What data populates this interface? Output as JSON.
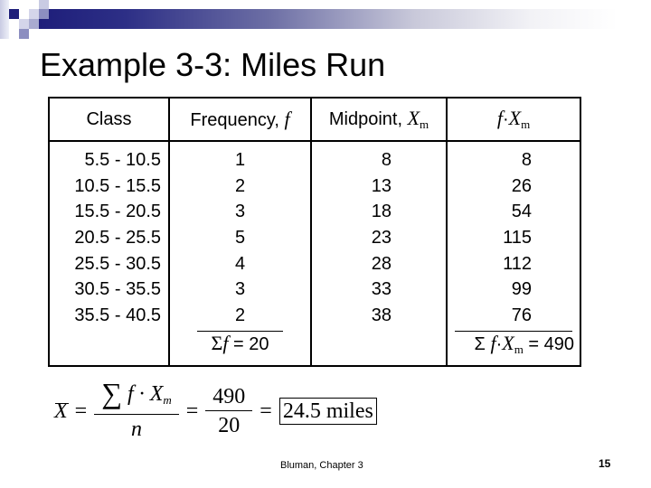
{
  "slide": {
    "title": "Example 3-3: Miles Run",
    "theme_colors": {
      "navy": "#1e1e7a",
      "medium": "#8c8ec0",
      "pale": "#c9cbe3"
    }
  },
  "table": {
    "headers": {
      "class": "Class",
      "frequency_text": "Frequency, ",
      "frequency_symbol": "f",
      "midpoint_text": "Midpoint, ",
      "midpoint_symbol": "X",
      "midpoint_sub": "m",
      "product_f": "f",
      "product_dot": "·",
      "product_x": "X",
      "product_sub": "m"
    },
    "rows": [
      {
        "class": "5.5 - 10.5",
        "f": "1",
        "xm": "8",
        "fxm": "8"
      },
      {
        "class": "10.5 - 15.5",
        "f": "2",
        "xm": "13",
        "fxm": "26"
      },
      {
        "class": "15.5 - 20.5",
        "f": "3",
        "xm": "18",
        "fxm": "54"
      },
      {
        "class": "20.5 - 25.5",
        "f": "5",
        "xm": "23",
        "fxm": "115"
      },
      {
        "class": "25.5 - 30.5",
        "f": "4",
        "xm": "28",
        "fxm": "112"
      },
      {
        "class": "30.5 - 35.5",
        "f": "3",
        "xm": "33",
        "fxm": "99"
      },
      {
        "class": "35.5 - 40.5",
        "f": "2",
        "xm": "38",
        "fxm": "76"
      }
    ],
    "sum_f": {
      "sigma": "Σ",
      "symbol": "f",
      "value": " = 20"
    },
    "sum_fxm": {
      "sigma": "Σ ",
      "f": "f",
      "dot": "·",
      "x": "X",
      "sub": "m",
      "value": " = 490"
    }
  },
  "formula": {
    "lhs": "X",
    "eq": "=",
    "sigma": "∑",
    "num_f": " f · X",
    "num_sub": "m",
    "den": "n",
    "num_value": "490",
    "den_value": "20",
    "answer": "24.5 miles"
  },
  "footer": {
    "source": "Bluman, Chapter 3",
    "page": "15"
  }
}
